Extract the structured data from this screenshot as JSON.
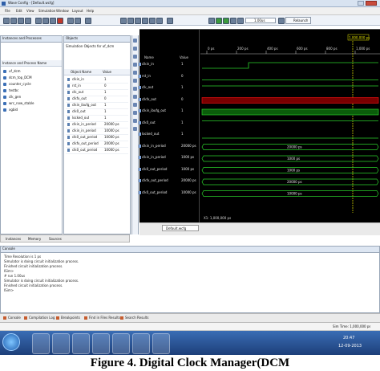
{
  "window": {
    "title": "Wave Config - [Default.wcfg]"
  },
  "menu": {
    "items": [
      "File",
      "Edit",
      "View",
      "Simulation",
      "Window",
      "Layout",
      "Help"
    ]
  },
  "toolbar": {
    "time_value": "1.00us",
    "relaunch_label": "Relaunch"
  },
  "instances": {
    "header": "Instances and Processes",
    "column": "Instance and Process Name",
    "rows": [
      "uf_dcm",
      "dcm_top_DCM",
      "counter_cycle",
      "testbc",
      "clk_gen",
      "wrc_now_stable",
      "xgbid"
    ]
  },
  "objects": {
    "header": "Objects",
    "subheader": "Simulation Objects for uf_dcm",
    "columns": [
      "Object Name",
      "Value"
    ],
    "rows": [
      {
        "name": "clkin_in",
        "value": "1"
      },
      {
        "name": "rst_in",
        "value": "0"
      },
      {
        "name": "clk_out",
        "value": "1"
      },
      {
        "name": "clkfx_out",
        "value": "0"
      },
      {
        "name": "clkin_ibufg_out",
        "value": "1"
      },
      {
        "name": "clk0_out",
        "value": "1"
      },
      {
        "name": "locked_out",
        "value": "1"
      },
      {
        "name": "clkin_in_period",
        "value": "20000 ps"
      },
      {
        "name": "clkin_in_period",
        "value": "10000 ps"
      },
      {
        "name": "clk0_out_period",
        "value": "10000 ps"
      },
      {
        "name": "clkfx_out_period",
        "value": "20000 ps"
      },
      {
        "name": "clk0_out_period",
        "value": "10000 ps"
      }
    ]
  },
  "wave": {
    "name_header": "Name",
    "value_header": "Value",
    "cursor_label": "1,000,000 ps",
    "time_ticks": [
      "0 ps",
      "200 ps",
      "400 ps",
      "600 ps",
      "800 ps",
      "1,000 ps"
    ],
    "bus_values": [
      "20000 ps",
      "1000 ps",
      "1000 ps",
      "20000 ps",
      "10000 ps"
    ],
    "footer_x": "X1: 1,000,000 ps",
    "tab_label": "Default.wcfg",
    "signals": [
      {
        "name": "clkin_in",
        "value": "1"
      },
      {
        "name": "rst_in",
        "value": "0"
      },
      {
        "name": "clk_out",
        "value": "1"
      },
      {
        "name": "clkfx_out",
        "value": "0"
      },
      {
        "name": "clkin_ibufg_out",
        "value": "1"
      },
      {
        "name": "clk0_out",
        "value": "1"
      },
      {
        "name": "locked_out",
        "value": "1"
      },
      {
        "name": "clkin_in_period",
        "value": "20000 ps"
      },
      {
        "name": "clkin_in_period",
        "value": "1000 ps"
      },
      {
        "name": "clk0_out_period",
        "value": "1000 ps"
      },
      {
        "name": "clkfx_out_period",
        "value": "20000 ps"
      },
      {
        "name": "clk0_out_period",
        "value": "10000 ps"
      }
    ]
  },
  "left_tabs": [
    "Instances",
    "Memory",
    "Sources"
  ],
  "console": {
    "header": "Console",
    "lines": [
      "Time Resolution is 1 ps",
      "Simulator is doing circuit initialization process.",
      "Finished circuit initialization process.",
      "ISim>",
      "# run 1.00us",
      "Simulator is doing circuit initialization process.",
      "Finished circuit initialization process.",
      "ISim>"
    ]
  },
  "bottom_tabs": [
    "Console",
    "Compilation Log",
    "Breakpoints",
    "Find in Files Results",
    "Search Results"
  ],
  "status": {
    "sim_time": "Sim Time: 1,000,000 ps"
  },
  "taskbar": {
    "clock_time": "20:47",
    "clock_date": "12-09-2013"
  },
  "caption": "Figure   4.  Digital Clock Manager(DCM"
}
